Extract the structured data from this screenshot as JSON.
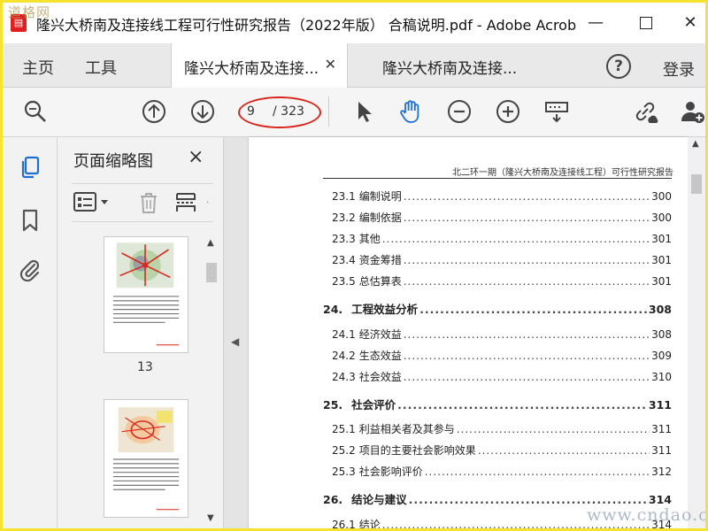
{
  "window": {
    "title": "隆兴大桥南及连接线工程可行性研究报告（2022年版） 合稿说明.pdf - Adobe Acrobat...",
    "watermark_logo": "道格网"
  },
  "menu": {
    "home": "主页",
    "tools": "工具"
  },
  "tabs": [
    {
      "label": "隆兴大桥南及连接...",
      "active": true
    },
    {
      "label": "隆兴大桥南及连接...",
      "active": false
    }
  ],
  "header_right": {
    "login": "登录",
    "help_icon": "?"
  },
  "toolbar": {
    "current_page": "9",
    "total_pages": "/ 323"
  },
  "panel": {
    "title": "页面缩略图",
    "close": "×",
    "thumbnails": [
      {
        "label": "13"
      },
      {
        "label": ""
      }
    ]
  },
  "document": {
    "running_header": "北二环一期（隆兴大桥南及连接线工程）可行性研究报告",
    "toc": [
      {
        "num": "23.1",
        "title": "编制说明",
        "page": "300",
        "major": false
      },
      {
        "num": "23.2",
        "title": "编制依据",
        "page": "300",
        "major": false
      },
      {
        "num": "23.3",
        "title": "其他",
        "page": "301",
        "major": false
      },
      {
        "num": "23.4",
        "title": "资金筹措",
        "page": "301",
        "major": false
      },
      {
        "num": "23.5",
        "title": "总估算表",
        "page": "301",
        "major": false
      },
      {
        "num": "24.",
        "title": "工程效益分析",
        "page": "308",
        "major": true
      },
      {
        "num": "24.1",
        "title": "经济效益",
        "page": "308",
        "major": false
      },
      {
        "num": "24.2",
        "title": "生态效益",
        "page": "309",
        "major": false
      },
      {
        "num": "24.3",
        "title": "社会效益",
        "page": "310",
        "major": false
      },
      {
        "num": "25.",
        "title": "社会评价",
        "page": "311",
        "major": true
      },
      {
        "num": "25.1",
        "title": "利益相关者及其参与",
        "page": "311",
        "major": false
      },
      {
        "num": "25.2",
        "title": "项目的主要社会影响效果",
        "page": "311",
        "major": false
      },
      {
        "num": "25.3",
        "title": "社会影响评价",
        "page": "312",
        "major": false
      },
      {
        "num": "26.",
        "title": "结论与建议",
        "page": "314",
        "major": true
      },
      {
        "num": "26.1",
        "title": "结论",
        "page": "314",
        "major": false
      }
    ]
  },
  "site_watermark": "www.cndao.com",
  "colors": {
    "accent_blue": "#1f6fd1",
    "annotation_red": "#d9261c",
    "frame_yellow": "#f5e330"
  }
}
